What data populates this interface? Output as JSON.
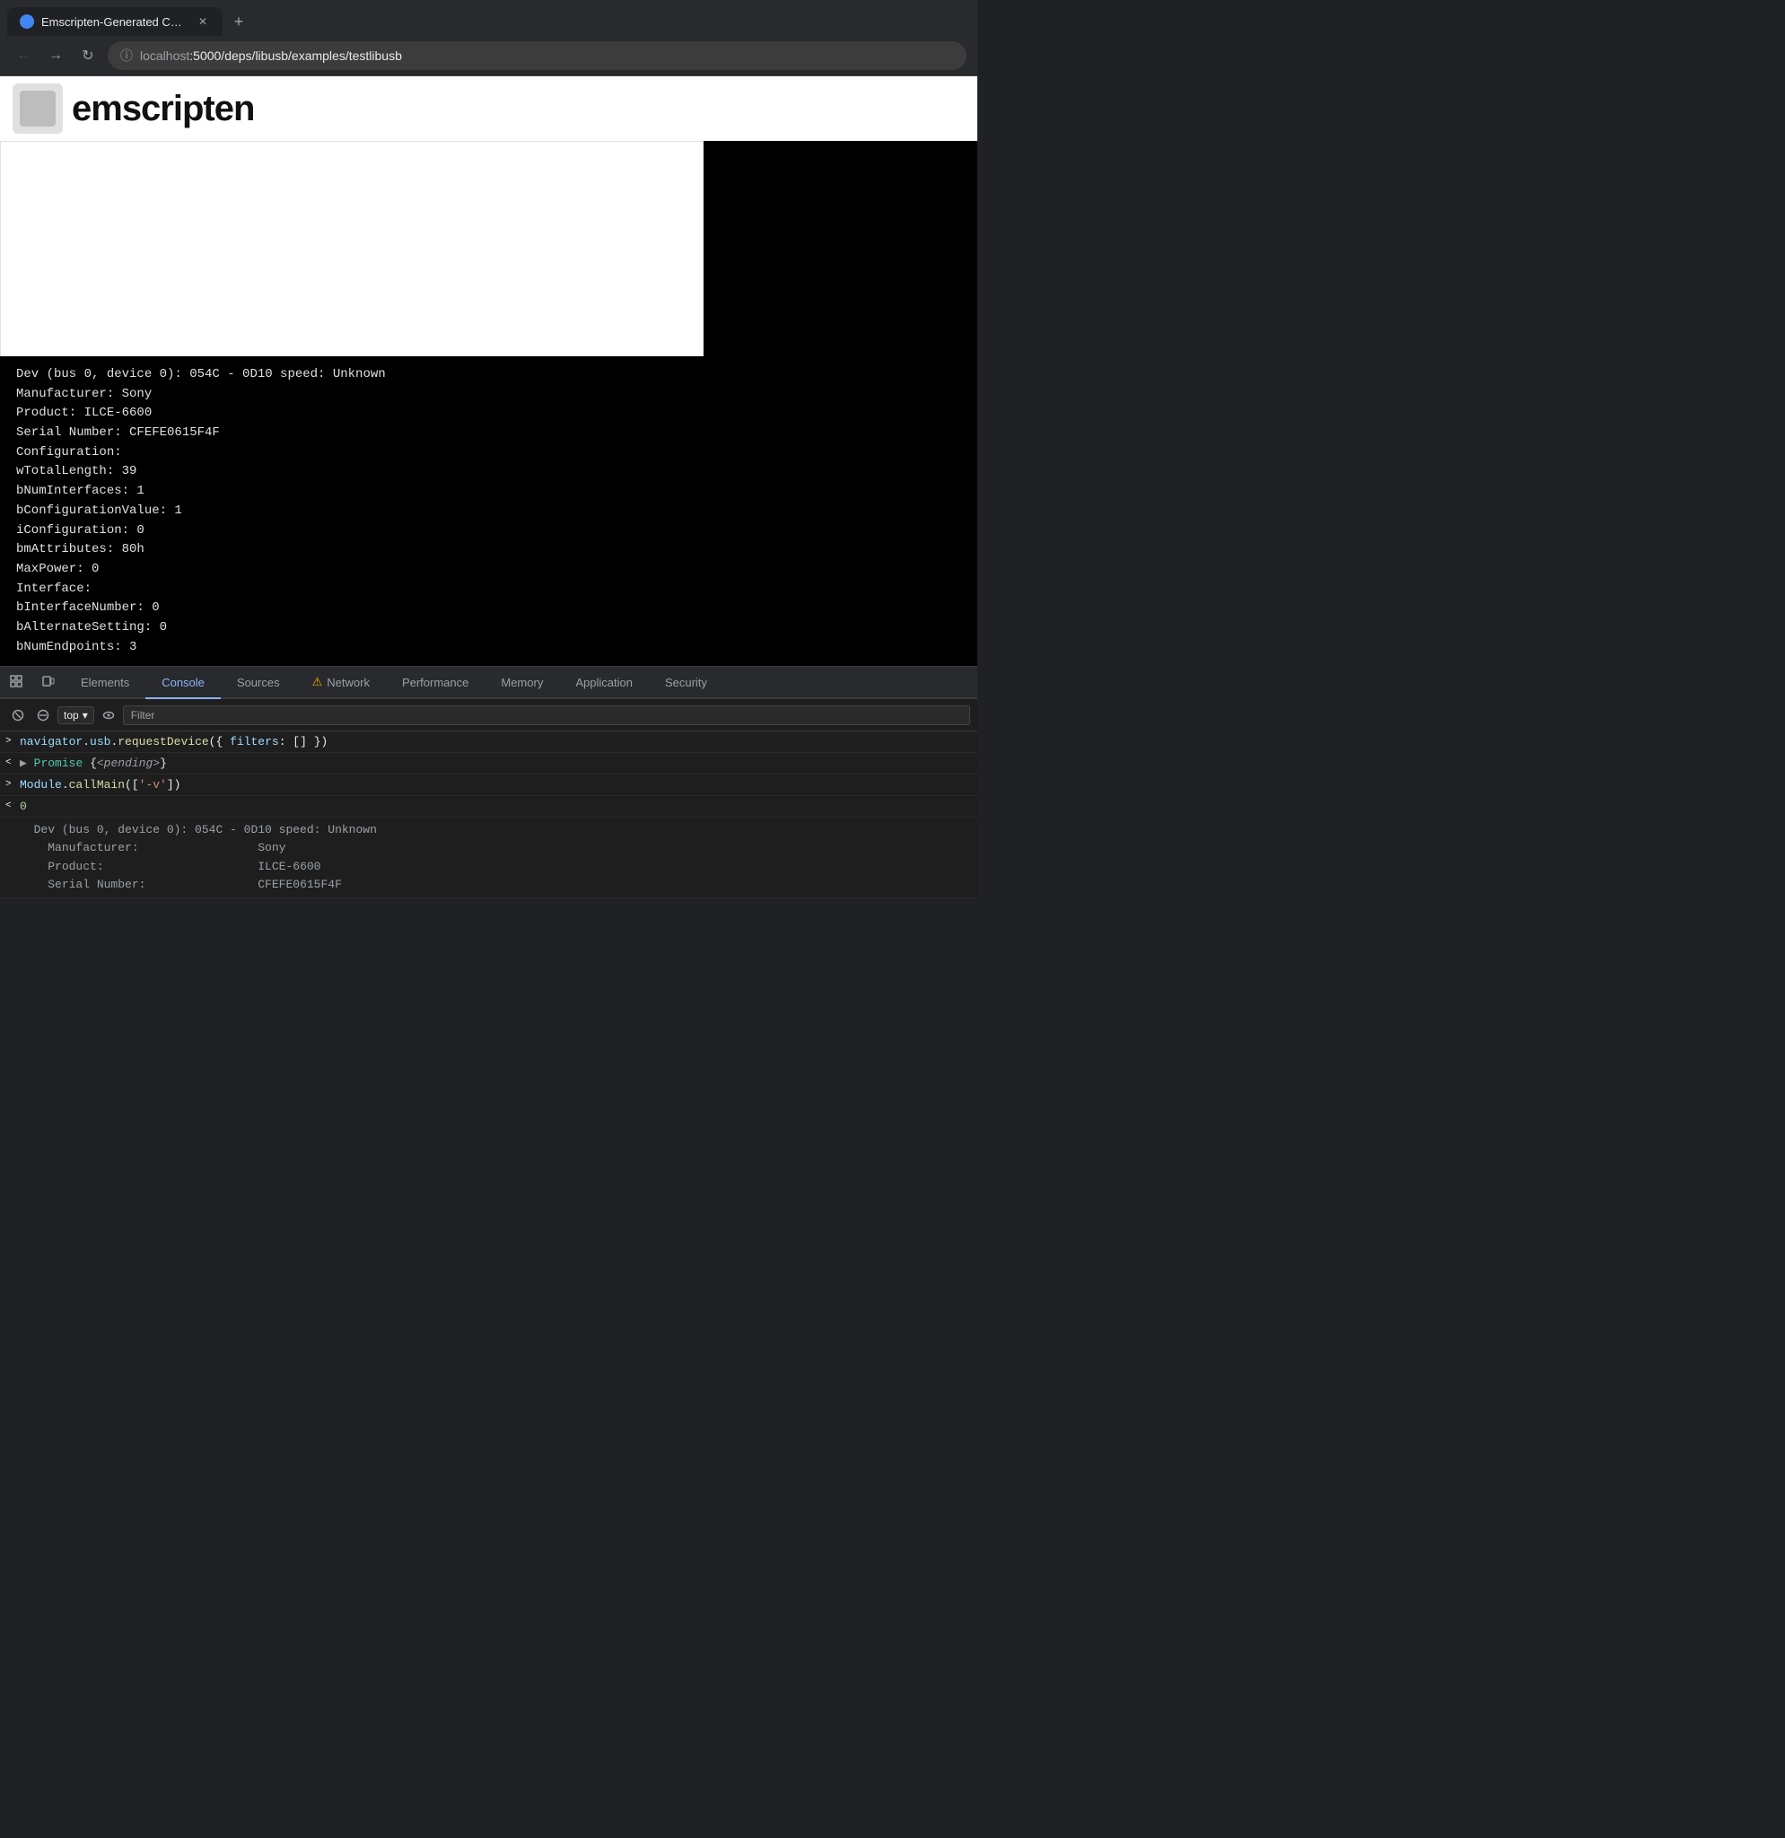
{
  "browser": {
    "tab_title": "Emscripten-Generated Code",
    "url_protocol": "localhost",
    "url_path": ":5000/deps/libusb/examples/testlibusb",
    "new_tab_label": "+"
  },
  "devtools": {
    "tabs": [
      {
        "id": "elements",
        "label": "Elements",
        "active": false,
        "warning": false
      },
      {
        "id": "console",
        "label": "Console",
        "active": true,
        "warning": false
      },
      {
        "id": "sources",
        "label": "Sources",
        "active": false,
        "warning": false
      },
      {
        "id": "network",
        "label": "Network",
        "active": false,
        "warning": true
      },
      {
        "id": "performance",
        "label": "Performance",
        "active": false,
        "warning": false
      },
      {
        "id": "memory",
        "label": "Memory",
        "active": false,
        "warning": false
      },
      {
        "id": "application",
        "label": "Application",
        "active": false,
        "warning": false
      },
      {
        "id": "security",
        "label": "Security",
        "active": false,
        "warning": false
      }
    ],
    "context_selector": {
      "label": "top",
      "chevron": "▾"
    },
    "filter_placeholder": "Filter"
  },
  "emscripten": {
    "title": "emscripten"
  },
  "terminal": {
    "lines": [
      "Dev (bus 0, device 0): 054C - 0D10 speed: Unknown",
      "  Manufacturer:                 Sony",
      "  Product:                      ILCE-6600",
      "  Serial Number:                CFEFE0615F4F",
      "  Configuration:",
      "    wTotalLength:               39",
      "    bNumInterfaces:             1",
      "    bConfigurationValue:        1",
      "    iConfiguration:             0",
      "    bmAttributes:               80h",
      "    MaxPower:                   0",
      "    Interface:",
      "      bInterfaceNumber:         0",
      "      bAlternateSetting:        0",
      "      bNumEndpoints:            3"
    ]
  },
  "console": {
    "entries": [
      {
        "type": "input",
        "arrow": ">",
        "parts": [
          {
            "text": "navigator",
            "class": "js-keyword"
          },
          {
            "text": ".",
            "class": "js-punctuation"
          },
          {
            "text": "usb",
            "class": "js-prop"
          },
          {
            "text": ".",
            "class": "js-punctuation"
          },
          {
            "text": "requestDevice",
            "class": "js-method"
          },
          {
            "text": "({ ",
            "class": "js-punctuation"
          },
          {
            "text": "filters",
            "class": "js-prop"
          },
          {
            "text": ": ",
            "class": "js-punctuation"
          },
          {
            "text": "[]",
            "class": "js-punctuation"
          },
          {
            "text": " })",
            "class": "js-punctuation"
          }
        ]
      },
      {
        "type": "output",
        "arrow": "<",
        "parts": [
          {
            "text": "▶ ",
            "class": "js-italic"
          },
          {
            "text": "Promise ",
            "class": "js-blue"
          },
          {
            "text": "{",
            "class": "js-punctuation"
          },
          {
            "text": "<pending>",
            "class": "js-italic"
          },
          {
            "text": "}",
            "class": "js-punctuation"
          }
        ]
      },
      {
        "type": "input",
        "arrow": ">",
        "parts": [
          {
            "text": "Module",
            "class": "js-keyword"
          },
          {
            "text": ".",
            "class": "js-punctuation"
          },
          {
            "text": "callMain",
            "class": "js-method"
          },
          {
            "text": "([",
            "class": "js-punctuation"
          },
          {
            "text": "'-v'",
            "class": "js-string"
          },
          {
            "text": "])",
            "class": "js-punctuation"
          }
        ]
      },
      {
        "type": "output",
        "arrow": "<",
        "parts": [
          {
            "text": "0",
            "class": "js-zero"
          }
        ]
      }
    ],
    "device_output": {
      "lines": [
        "  Dev (bus 0, device 0): 054C - 0D10 speed: Unknown",
        "    Manufacturer:                 Sony",
        "    Product:                      ILCE-6600",
        "    Serial Number:                CFEFE0615F4F"
      ]
    }
  }
}
